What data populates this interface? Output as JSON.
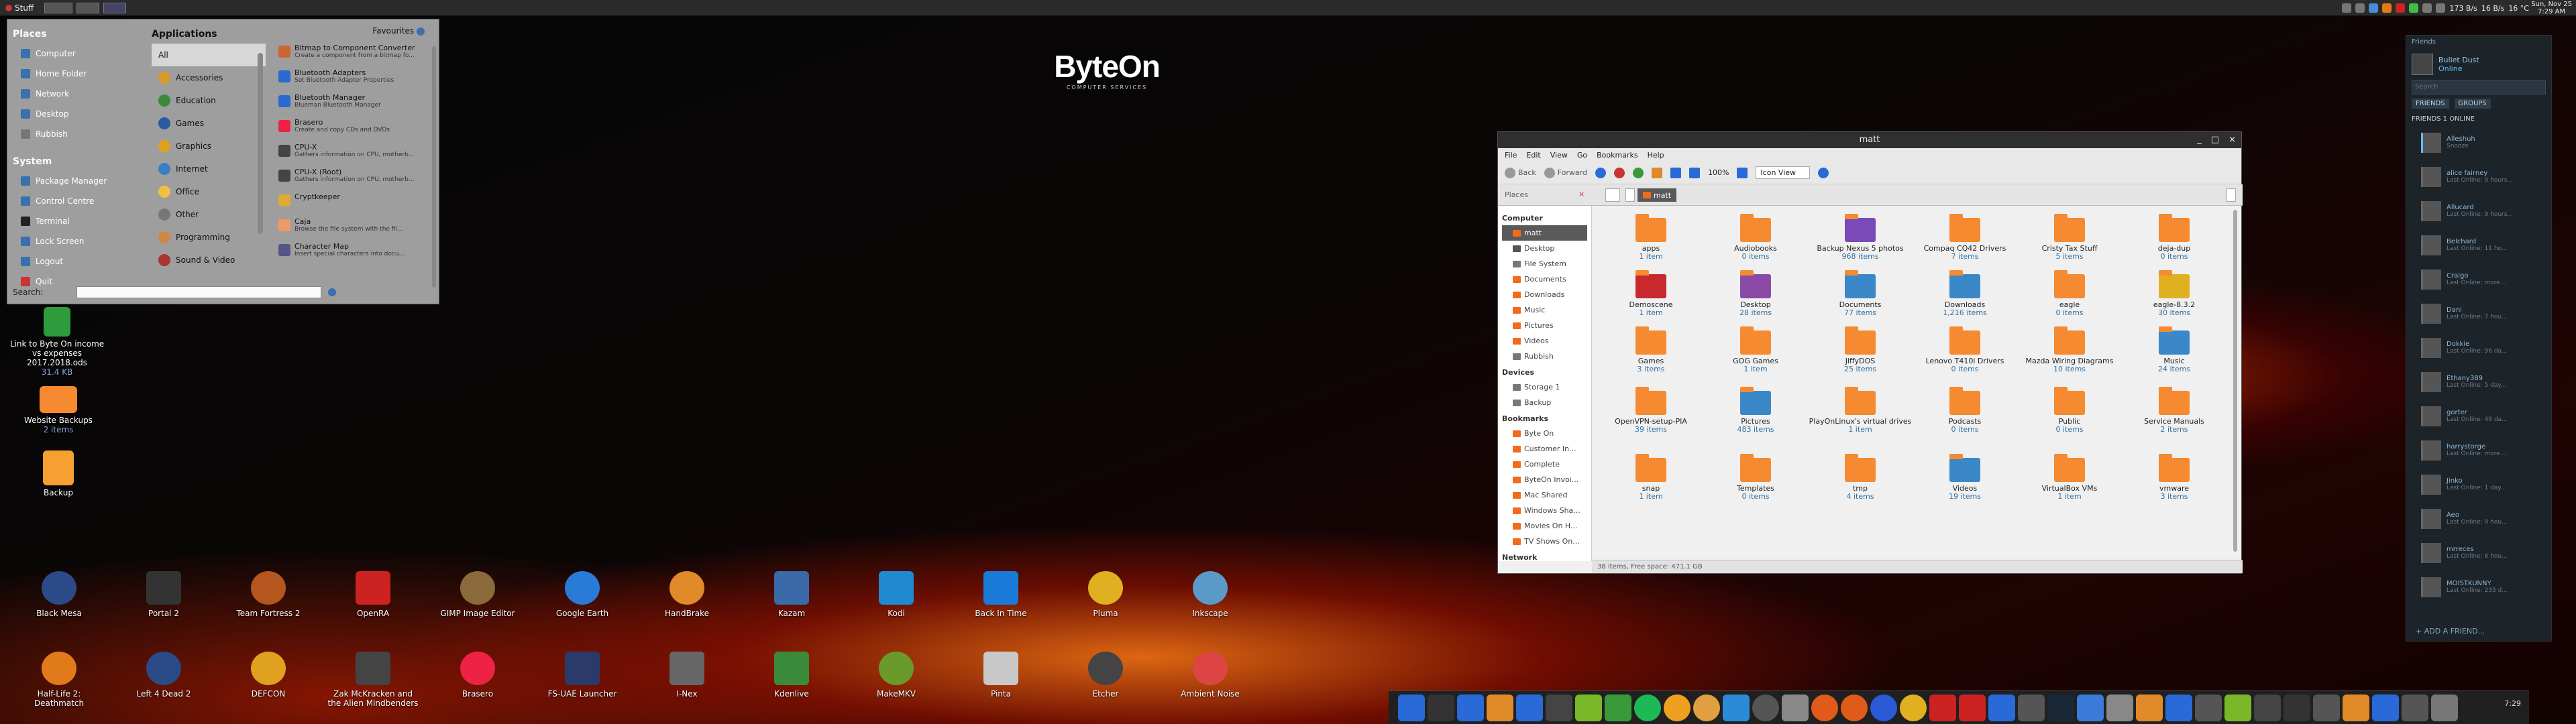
{
  "topbar": {
    "menu_label": "Stuff",
    "clock_line1": "Sun, Nov 25",
    "clock_line2": "7:29 AM",
    "tray_text": [
      "173 B/s",
      "16 B/s",
      "16 °C"
    ]
  },
  "logo": {
    "main": "ByteOn",
    "sub": "COMPUTER SERVICES"
  },
  "start_menu": {
    "places_header": "Places",
    "places": [
      "Computer",
      "Home Folder",
      "Network",
      "Desktop",
      "Rubbish"
    ],
    "system_header": "System",
    "system": [
      "Package Manager",
      "Control Centre",
      "Terminal",
      "Lock Screen",
      "Logout",
      "Quit"
    ],
    "applications_header": "Applications",
    "favourites_label": "Favourites",
    "categories": [
      "All",
      "Accessories",
      "Education",
      "Games",
      "Graphics",
      "Internet",
      "Office",
      "Other",
      "Programming",
      "Sound & Video"
    ],
    "apps": [
      {
        "name": "Bitmap to Component Converter",
        "desc": "Create a component from a bitmap fo..."
      },
      {
        "name": "Bluetooth Adapters",
        "desc": "Set Bluetooth Adapter Properties"
      },
      {
        "name": "Bluetooth Manager",
        "desc": "Blueman Bluetooth Manager"
      },
      {
        "name": "Brasero",
        "desc": "Create and copy CDs and DVDs"
      },
      {
        "name": "CPU-X",
        "desc": "Gathers information on CPU, motherb..."
      },
      {
        "name": "CPU-X (Root)",
        "desc": "Gathers information on CPU, motherb..."
      },
      {
        "name": "Cryptkeeper",
        "desc": ""
      },
      {
        "name": "Caja",
        "desc": "Browse the file system with the fil..."
      },
      {
        "name": "Character Map",
        "desc": "Insert special characters into docu..."
      }
    ],
    "search_label": "Search:"
  },
  "desktop_icons": [
    {
      "label": "Link to Byte On income vs expenses 2017.2018.ods",
      "sub": "31.4 KB"
    },
    {
      "label": "Website Backups",
      "sub": "2 items"
    },
    {
      "label": "Backup",
      "sub": ""
    }
  ],
  "dock_row1": [
    "Black Mesa",
    "Portal 2",
    "Team Fortress 2",
    "OpenRA",
    "GIMP Image Editor",
    "Google Earth",
    "HandBrake",
    "Kazam",
    "Kodi",
    "Back In Time",
    "Pluma",
    "Inkscape"
  ],
  "dock_row2": [
    "Half-Life 2: Deathmatch",
    "Left 4 Dead 2",
    "DEFCON",
    "Zak McKracken and the Alien Mindbenders",
    "Brasero",
    "FS-UAE Launcher",
    "I-Nex",
    "Kdenlive",
    "MakeMKV",
    "Pinta",
    "Etcher",
    "Ambient Noise"
  ],
  "panel": {
    "clock": "7:29"
  },
  "file_manager": {
    "title": "matt",
    "menu": [
      "File",
      "Edit",
      "View",
      "Go",
      "Bookmarks",
      "Help"
    ],
    "back": "Back",
    "forward": "Forward",
    "zoom": "100%",
    "view_mode": "Icon View",
    "places_label": "Places",
    "crumb": "matt",
    "sidebar": {
      "computer_h": "Computer",
      "computer": [
        "matt",
        "Desktop",
        "File System",
        "Documents",
        "Downloads",
        "Music",
        "Pictures",
        "Videos",
        "Rubbish"
      ],
      "devices_h": "Devices",
      "devices": [
        "Storage 1",
        "Backup"
      ],
      "bookmarks_h": "Bookmarks",
      "bookmarks": [
        "Byte On",
        "Customer In...",
        "Complete",
        "ByteOn Invoi...",
        "Mac Shared",
        "Windows Sha...",
        "Movies On H...",
        "TV Shows On..."
      ],
      "network_h": "Network"
    },
    "items": [
      {
        "name": "apps",
        "count": "1 item",
        "col": 0,
        "row": 0
      },
      {
        "name": "Audiobooks",
        "count": "0 items",
        "col": 1,
        "row": 0
      },
      {
        "name": "Backup Nexus 5 photos",
        "count": "968 items",
        "col": 2,
        "row": 0
      },
      {
        "name": "Compaq CQ42 Drivers",
        "count": "7 items",
        "col": 3,
        "row": 0
      },
      {
        "name": "Cristy Tax Stuff",
        "count": "5 items",
        "col": 4,
        "row": 0
      },
      {
        "name": "deja-dup",
        "count": "0 items",
        "col": 5,
        "row": 0
      },
      {
        "name": "Demoscene",
        "count": "1 item",
        "col": 0,
        "row": 1
      },
      {
        "name": "Desktop",
        "count": "28 items",
        "col": 1,
        "row": 1
      },
      {
        "name": "Documents",
        "count": "77 items",
        "col": 2,
        "row": 1
      },
      {
        "name": "Downloads",
        "count": "1,216 items",
        "col": 3,
        "row": 1
      },
      {
        "name": "eagle",
        "count": "0 items",
        "col": 4,
        "row": 1
      },
      {
        "name": "eagle-8.3.2",
        "count": "30 items",
        "col": 5,
        "row": 1
      },
      {
        "name": "Games",
        "count": "3 items",
        "col": 0,
        "row": 2
      },
      {
        "name": "GOG Games",
        "count": "1 item",
        "col": 1,
        "row": 2
      },
      {
        "name": "JiffyDOS",
        "count": "25 items",
        "col": 2,
        "row": 2
      },
      {
        "name": "Lenovo T410i Drivers",
        "count": "0 items",
        "col": 3,
        "row": 2
      },
      {
        "name": "Mazda Wiring Diagrams",
        "count": "10 items",
        "col": 4,
        "row": 2
      },
      {
        "name": "Music",
        "count": "24 items",
        "col": 5,
        "row": 2
      },
      {
        "name": "OpenVPN-setup-PIA",
        "count": "39 items",
        "col": 0,
        "row": 3
      },
      {
        "name": "Pictures",
        "count": "483 items",
        "col": 1,
        "row": 3
      },
      {
        "name": "PlayOnLinux's virtual drives",
        "count": "1 item",
        "col": 2,
        "row": 3
      },
      {
        "name": "Podcasts",
        "count": "0 items",
        "col": 3,
        "row": 3
      },
      {
        "name": "Public",
        "count": "0 items",
        "col": 4,
        "row": 3
      },
      {
        "name": "Service Manuals",
        "count": "2 items",
        "col": 5,
        "row": 3
      },
      {
        "name": "snap",
        "count": "1 item",
        "col": 0,
        "row": 4
      },
      {
        "name": "Templates",
        "count": "0 items",
        "col": 1,
        "row": 4
      },
      {
        "name": "tmp",
        "count": "4 items",
        "col": 2,
        "row": 4
      },
      {
        "name": "Videos",
        "count": "19 items",
        "col": 3,
        "row": 4
      },
      {
        "name": "VirtualBox VMs",
        "count": "1 item",
        "col": 4,
        "row": 4
      },
      {
        "name": "vmware",
        "count": "3 items",
        "col": 5,
        "row": 4
      }
    ],
    "status": "38 items, Free space: 471.1 GB"
  },
  "steam": {
    "header": "Friends",
    "user_name": "Bullet Dust",
    "user_status": "Online",
    "search_placeholder": "Search",
    "tabs": [
      "FRIENDS",
      "GROUPS"
    ],
    "friends_header": "FRIENDS 1 ONLINE",
    "friends": [
      {
        "name": "Alleshuh",
        "status": "Snooze"
      },
      {
        "name": "alice fairney",
        "status": "Last Online: 9 hours..."
      },
      {
        "name": "Allucard",
        "status": "Last Online: 9 hours..."
      },
      {
        "name": "Belchard",
        "status": "Last Online: 11 ho..."
      },
      {
        "name": "Craigo",
        "status": "Last Online: more..."
      },
      {
        "name": "Dani",
        "status": "Last Online: 7 hou..."
      },
      {
        "name": "Dokkie",
        "status": "Last Online: 96 da..."
      },
      {
        "name": "Ethany389",
        "status": "Last Online: 5 day..."
      },
      {
        "name": "gorter",
        "status": "Last Online: 49 da..."
      },
      {
        "name": "harrystorge",
        "status": "Last Online: more..."
      },
      {
        "name": "Jinko",
        "status": "Last Online: 1 day..."
      },
      {
        "name": "Aeo",
        "status": "Last Online: 9 hou..."
      },
      {
        "name": "mrreces",
        "status": "Last Online: 6 hou..."
      },
      {
        "name": "MOISTKUNNY",
        "status": "Last Online: 235 d..."
      }
    ],
    "add_friend": "+ ADD A FRIEND..."
  }
}
